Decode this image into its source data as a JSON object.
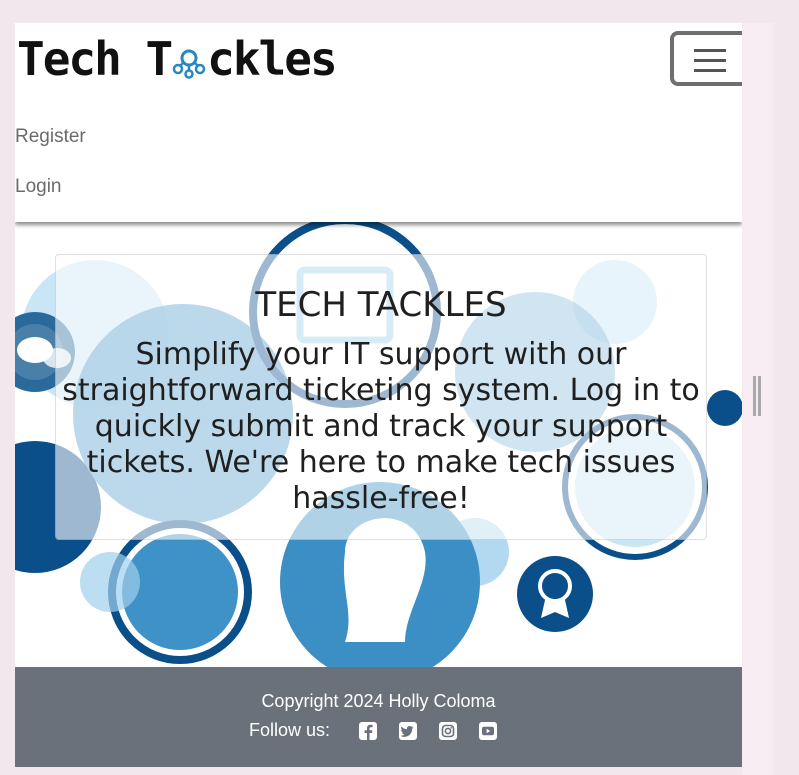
{
  "navbar": {
    "brand": {
      "part1": "Tech T",
      "logo_icon": "octopus-logo-icon",
      "part2": "ckles"
    },
    "toggler_icon": "hamburger-menu-icon",
    "links": [
      {
        "label": "Register"
      },
      {
        "label": "Login"
      }
    ]
  },
  "hero": {
    "title": "TECH TACKLES",
    "text": "Simplify your IT support with our straightforward ticketing system. Log in to quickly submit and track your support tickets. We're here to make tech issues hassle-free!"
  },
  "footer": {
    "copyright": "Copyright 2024 Holly Coloma",
    "follow_label": "Follow us:",
    "social": [
      {
        "icon": "facebook-icon"
      },
      {
        "icon": "twitter-icon"
      },
      {
        "icon": "instagram-icon"
      },
      {
        "icon": "youtube-icon"
      }
    ]
  },
  "colors": {
    "footer_bg": "#6b717b",
    "icon_dark_blue": "#0b4f8a",
    "icon_mid_blue": "#2a86c1",
    "icon_light_blue": "#9fd0ec"
  }
}
